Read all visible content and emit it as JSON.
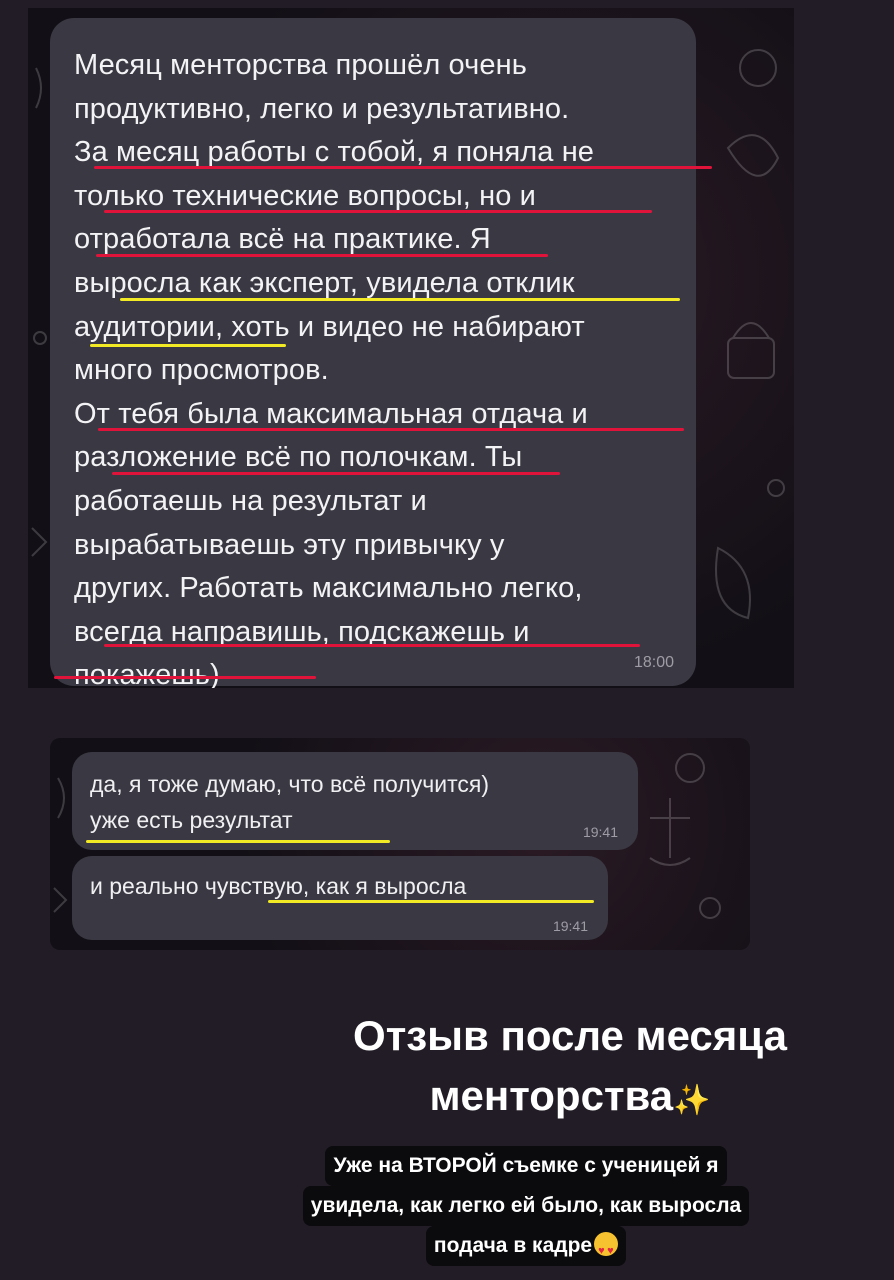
{
  "chat1": {
    "message": "Месяц менторства прошёл очень\nпродуктивно, легко и результативно.\nЗа месяц работы с тобой, я поняла не\nтолько технические вопросы, но и\nотработала всё на практике. Я\nвыросла  как эксперт, увидела отклик\nаудитории, хоть и  видео не набирают\nмного просмотров.\nОт тебя была максимальная отдача и\nразложение всё по полочкам. Ты\nработаешь на результат и\nвырабатываешь эту привычку у\nдругих. Работать максимально легко,\nвсегда направишь, подскажешь и\nпокажешь)",
    "time": "18:00"
  },
  "chat2": {
    "message_a": "да, я тоже думаю, что всё получится)\nуже есть результат",
    "time_a": "19:41",
    "message_b": "и реально чувствую, как я выросла",
    "time_b": "19:41"
  },
  "caption": {
    "title_line1": "Отзыв после месяца",
    "title_line2": "менторства",
    "sparkle": "✨",
    "sub_line1": "Уже на ВТОРОЙ съемке с ученицей я",
    "sub_line2": "увидела, как легко ей было, как выросла",
    "sub_line3": "подача в кадре",
    "emoji": "heart-eyes-emoji"
  },
  "colors": {
    "underline_red": "#e0143a",
    "underline_yellow": "#f1ea24",
    "bubble": "#3a3842",
    "background": "#221c26"
  }
}
